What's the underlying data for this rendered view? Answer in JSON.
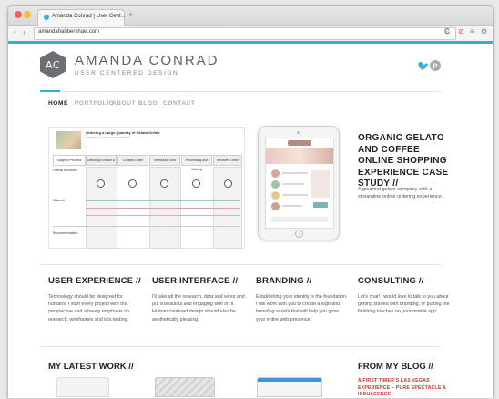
{
  "browser": {
    "tab_title": "Amanda Conrad | User Cent...",
    "tab_close": "×",
    "new_tab": "+",
    "url": "amandahabbershaw.com",
    "back": "‹",
    "forward": "›",
    "star": "☆",
    "reload": "C",
    "icons": [
      "reload-icon",
      "stop-icon",
      "menu-icon",
      "extension-icon"
    ]
  },
  "brand": {
    "monogram": "AC",
    "name": "AMANDA CONRAD",
    "tagline": "USER CENTERED DESIGN"
  },
  "social": [
    "twitter-icon",
    "pinterest-icon"
  ],
  "nav": [
    {
      "label": "HOME",
      "active": true
    },
    {
      "label": "PORTFOLIO",
      "active": false
    },
    {
      "label": "ABOUT",
      "active": false
    },
    {
      "label": "BLOG",
      "active": false
    },
    {
      "label": "CONTACT",
      "active": false
    }
  ],
  "wireframe": {
    "title": "Ordering a Large Quantity of Gelato Online",
    "subtitle": "PERSONA: LAURA THE HOSTESS",
    "columns": [
      "Stage of Process",
      "Deciding to Make a Gelato Party",
      "Creates Order",
      "Verification and Checkout",
      "Processing and Waiting",
      "Recieves Order"
    ],
    "rows": [
      "Overall Emotions",
      "Channel",
      "Recommendation"
    ]
  },
  "feature": {
    "title": "ORGANIC GELATO AND COFFEE ONLINE SHOPPING EXPERIENCE CASE STUDY //",
    "description": "A gourmet gelato company with a streamline online ordering experience."
  },
  "services": [
    {
      "title": "USER EXPERIENCE //",
      "text": "Technology should be designed for humans! I start every project with this perspective and a heavy emphasis on research, wireframes and lots testing."
    },
    {
      "title": "USER INTERFACE //",
      "text": "I'll take all the research, data and wires and put a beautiful and engaging skin on it. Human centered design should also be aesthetically pleasing."
    },
    {
      "title": "BRANDING //",
      "text": "Establishing your identity is the foundation. I will work with you to create a logo and branding assets that will help you grow your entire web presence."
    },
    {
      "title": "CONSULTING //",
      "text": "Let's chat! I would love to talk to you about getting started with branding, or putting the finishing touches on your mobile app."
    }
  ],
  "work": {
    "title": "MY LATEST WORK //"
  },
  "blog": {
    "title": "FROM MY BLOG //",
    "post": "A FIRST TIMER'S LAS VEGAS EXPERIENCE – PURE SPECTACLE & INDULGENCE"
  },
  "colors": {
    "accent": "#2bb5c6",
    "blog_link": "#c0392b",
    "logo": "#6c6f73"
  }
}
